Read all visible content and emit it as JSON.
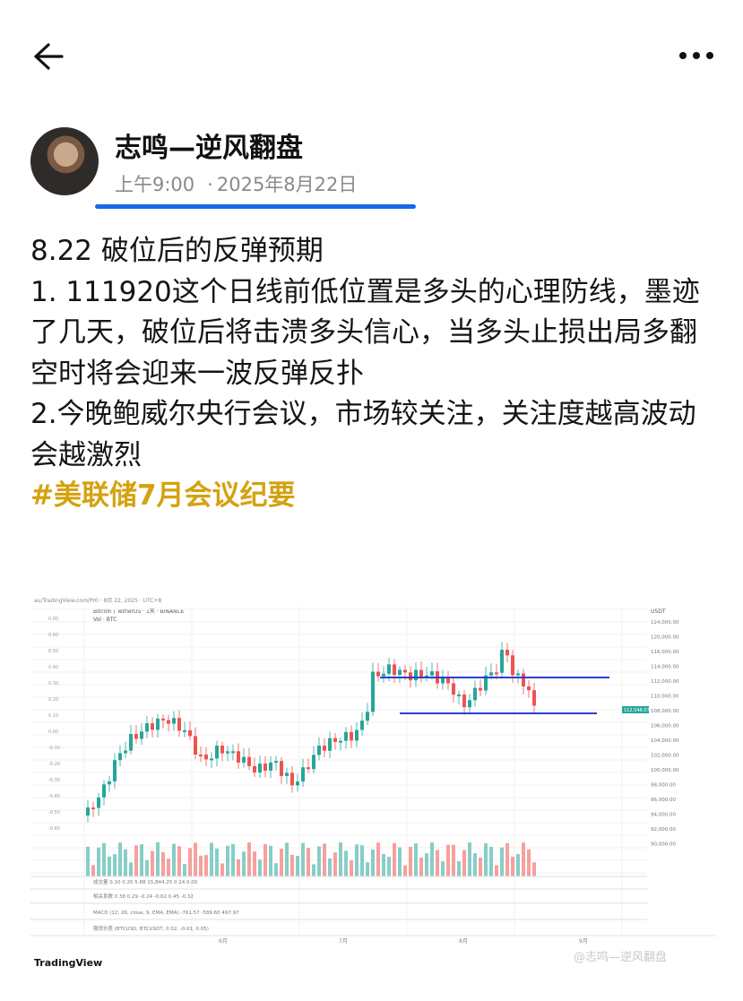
{
  "post": {
    "author_name": "志鸣—逆风翻盘",
    "time": "上午9:00",
    "separator": "·",
    "date": "2025年8月22日",
    "lines": [
      "8.22 破位后的反弹预期",
      "1. 111920这个日线前低位置是多头的心理防线，墨迹了几天，破位后将击溃多头信心，当多头止损出局多翻空时将会迎来一波反弹反扑",
      "2.今晚鲍威尔央行会议，市场较关注，关注度越高波动会越激烈"
    ],
    "hashtag": "#美联储7月会议纪要"
  },
  "chart_image": {
    "source_label": "TradingView",
    "pair_label": "Bitcoin / TetherUS · 1天 · BINANCE",
    "vol_label": "Vol · BTC",
    "price_axis_label": "USDT",
    "price_ticks": [
      "124,000.00",
      "120,000.00",
      "116,000.00",
      "114,000.00",
      "112,000.00",
      "110,000.00",
      "108,000.00",
      "106,000.00",
      "104,000.00",
      "102,000.00",
      "100,000.00",
      "98,000.00",
      "96,000.00",
      "94,000.00",
      "92,000.00",
      "90,000.00"
    ],
    "current_price_tag": "112,548.07",
    "month_labels": [
      "6月",
      "7月",
      "8月",
      "9月"
    ],
    "watermark": "@志鸣—逆风翻盘",
    "accent_blue": "#2a3fd6",
    "up_color": "#26a69a",
    "down_color": "#ef5350"
  },
  "icons": {
    "back": "arrow-left-icon",
    "more": "more-horizontal-icon"
  }
}
